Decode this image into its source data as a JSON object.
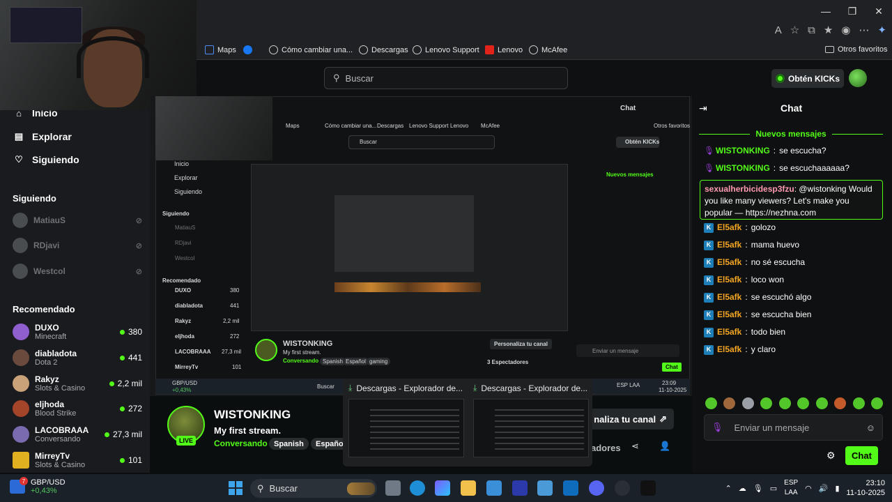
{
  "browser": {
    "window_controls": [
      "—",
      "❐",
      "✕"
    ],
    "favorites": [
      {
        "label": "Maps",
        "icon": "maps-icon"
      },
      {
        "label": "",
        "icon": "facebook-icon"
      },
      {
        "label": "Cómo cambiar una...",
        "icon": "globe-icon"
      },
      {
        "label": "Descargas",
        "icon": "globe-icon"
      },
      {
        "label": "Lenovo Support",
        "icon": "globe-icon"
      },
      {
        "label": "Lenovo",
        "icon": "lenovo-icon"
      },
      {
        "label": "McAfee",
        "icon": "globe-icon"
      }
    ],
    "other_favorites": "Otros favoritos"
  },
  "header": {
    "search_placeholder": "Buscar",
    "kicks_button": "Obtén KICKs"
  },
  "sidebar": {
    "nav": [
      {
        "label": "Inicio",
        "icon": "home-icon"
      },
      {
        "label": "Explorar",
        "icon": "browse-icon"
      },
      {
        "label": "Siguiendo",
        "icon": "heart-icon"
      }
    ],
    "following_title": "Siguiendo",
    "following": [
      {
        "name": "MatiauS"
      },
      {
        "name": "RDjavi"
      },
      {
        "name": "Westcol"
      }
    ],
    "recommended_title": "Recomendado",
    "recommended": [
      {
        "name": "DUXO",
        "game": "Minecraft",
        "viewers": "380"
      },
      {
        "name": "diabladota",
        "game": "Dota 2",
        "viewers": "441"
      },
      {
        "name": "Rakyz",
        "game": "Slots & Casino",
        "viewers": "2,2 mil"
      },
      {
        "name": "eljhoda",
        "game": "Blood Strike",
        "viewers": "272"
      },
      {
        "name": "LACOBRAAA",
        "game": "Conversando",
        "viewers": "27,3 mil"
      },
      {
        "name": "MirreyTv",
        "game": "Slots & Casino",
        "viewers": "101"
      }
    ]
  },
  "stream": {
    "streamer": "WISTONKING",
    "live_badge": "LIVE",
    "title": "My first stream.",
    "category": "Conversando",
    "tags": [
      "Spanish",
      "Español"
    ],
    "customize_button": "naliza tu canal",
    "viewers_fragment": "adores"
  },
  "nested": {
    "streamer": "WISTONKING",
    "title": "My first stream.",
    "category": "Conversando",
    "tags": [
      "Spanish",
      "Español",
      "gaming"
    ],
    "customize": "Personaliza tu canal",
    "viewers": "3 Espectadores",
    "chat_title": "Chat",
    "new_msgs": "Nuevos mensajes",
    "input": "Enviar un mensaje",
    "send": "Chat",
    "search": "Buscar",
    "kicks": "Obtén KICKs",
    "nav": [
      "Inicio",
      "Explorar",
      "Siguiendo"
    ],
    "following_title": "Siguiendo",
    "following": [
      "MatiauS",
      "RDjavi",
      "Westcol"
    ],
    "recommended_title": "Recomendado",
    "recommended": [
      {
        "name": "DUXO",
        "game": "Minecraft",
        "viewers": "380"
      },
      {
        "name": "diabladota",
        "game": "Dota 2",
        "viewers": "441"
      },
      {
        "name": "Rakyz",
        "game": "Slots & Casino",
        "viewers": "2,2 mil"
      },
      {
        "name": "eljhoda",
        "game": "Blood Strike",
        "viewers": "272"
      },
      {
        "name": "LACOBRAAA",
        "game": "Conversando",
        "viewers": "27,3 mil"
      },
      {
        "name": "MirreyTv",
        "game": "Slots & Casino",
        "viewers": "101"
      }
    ],
    "fav": [
      "Maps",
      "Cómo cambiar una...",
      "Descargas",
      "Lenovo Support",
      "Lenovo",
      "McAfee",
      "Otros favoritos"
    ],
    "taskbar_search": "Buscar",
    "ticker": "GBP/USD",
    "ticker_change": "+0,43%",
    "time": "23:09",
    "date": "11-10-2025",
    "lang": "ESP LAA"
  },
  "previews": [
    {
      "title": "Descargas - Explorador de..."
    },
    {
      "title": "Descargas - Explorador de..."
    }
  ],
  "chat": {
    "title": "Chat",
    "new_messages": "Nuevos mensajes",
    "messages": [
      {
        "user": "WISTONKING",
        "text": "se escucha?",
        "badge": "mic"
      },
      {
        "user": "WISTONKING",
        "text": "se escuchaaaaaa?",
        "badge": "mic"
      },
      {
        "user": "El5afk",
        "text": "golozo",
        "badge": "kick"
      },
      {
        "user": "El5afk",
        "text": "mama huevo",
        "badge": "kick"
      },
      {
        "user": "El5afk",
        "text": "no sé escucha",
        "badge": "kick"
      },
      {
        "user": "El5afk",
        "text": "loco won",
        "badge": "kick"
      },
      {
        "user": "El5afk",
        "text": "se escuchó algo",
        "badge": "kick"
      },
      {
        "user": "El5afk",
        "text": "se escucha bien",
        "badge": "kick"
      },
      {
        "user": "El5afk",
        "text": "todo bien",
        "badge": "kick"
      },
      {
        "user": "El5afk",
        "text": "y claro",
        "badge": "kick"
      }
    ],
    "highlight": {
      "user": "sexualherbicidesp3fzu",
      "text": "@wistonking Would you like many viewers? Let's make you popular — https://nezhna.com"
    },
    "input_placeholder": "Enviar un mensaje",
    "send_label": "Chat"
  },
  "taskbar": {
    "ticker_name": "GBP/USD",
    "ticker_change": "+0,43%",
    "ticker_badge": "7",
    "search": "Buscar",
    "lang_line1": "ESP",
    "lang_line2": "LAA",
    "time": "23:10",
    "date": "11-10-2025"
  },
  "colors": {
    "accent": "#53fc18",
    "background": "#0b0e0f"
  }
}
